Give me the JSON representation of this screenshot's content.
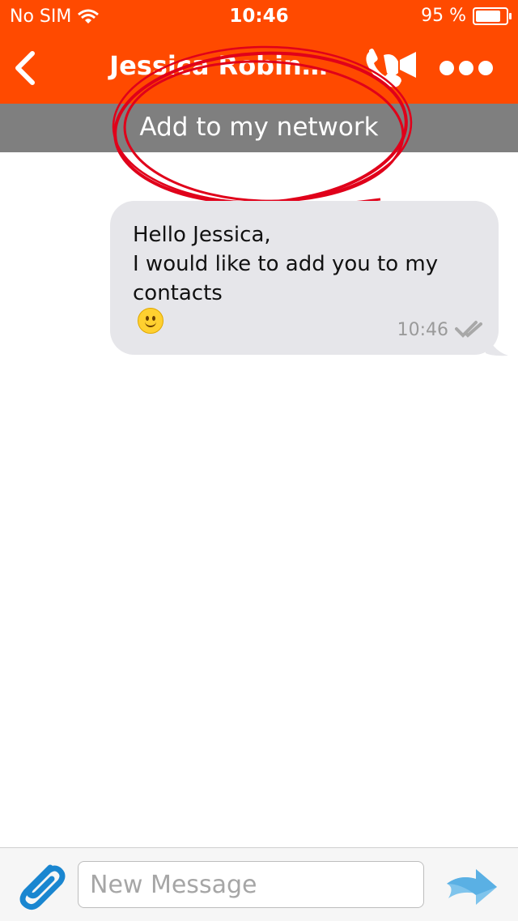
{
  "status_bar": {
    "carrier": "No SIM",
    "time": "10:46",
    "battery": "95 %",
    "battery_level": 0.95
  },
  "navbar": {
    "title": "Jessica Robin…",
    "back_icon": "chevron-left-icon",
    "call_icon": "phone-video-icon",
    "more_icon": "more-dots-icon"
  },
  "banner": {
    "label": "Add to my network"
  },
  "message": {
    "line1": "Hello Jessica,",
    "line2": "I would like to add you to my",
    "line3": "contacts",
    "emoji": "smile-emoji",
    "time": "10:46",
    "status_icon": "double-check-icon"
  },
  "composer": {
    "placeholder": "New Message",
    "attach_icon": "paperclip-icon",
    "send_icon": "send-arrow-icon"
  },
  "colors": {
    "brand_orange": "#ff4a00",
    "banner_grey": "#7f7f7f",
    "bubble_grey": "#e6e6ea",
    "accent_blue": "#1a86d0",
    "annotation_red": "#e0001a"
  }
}
